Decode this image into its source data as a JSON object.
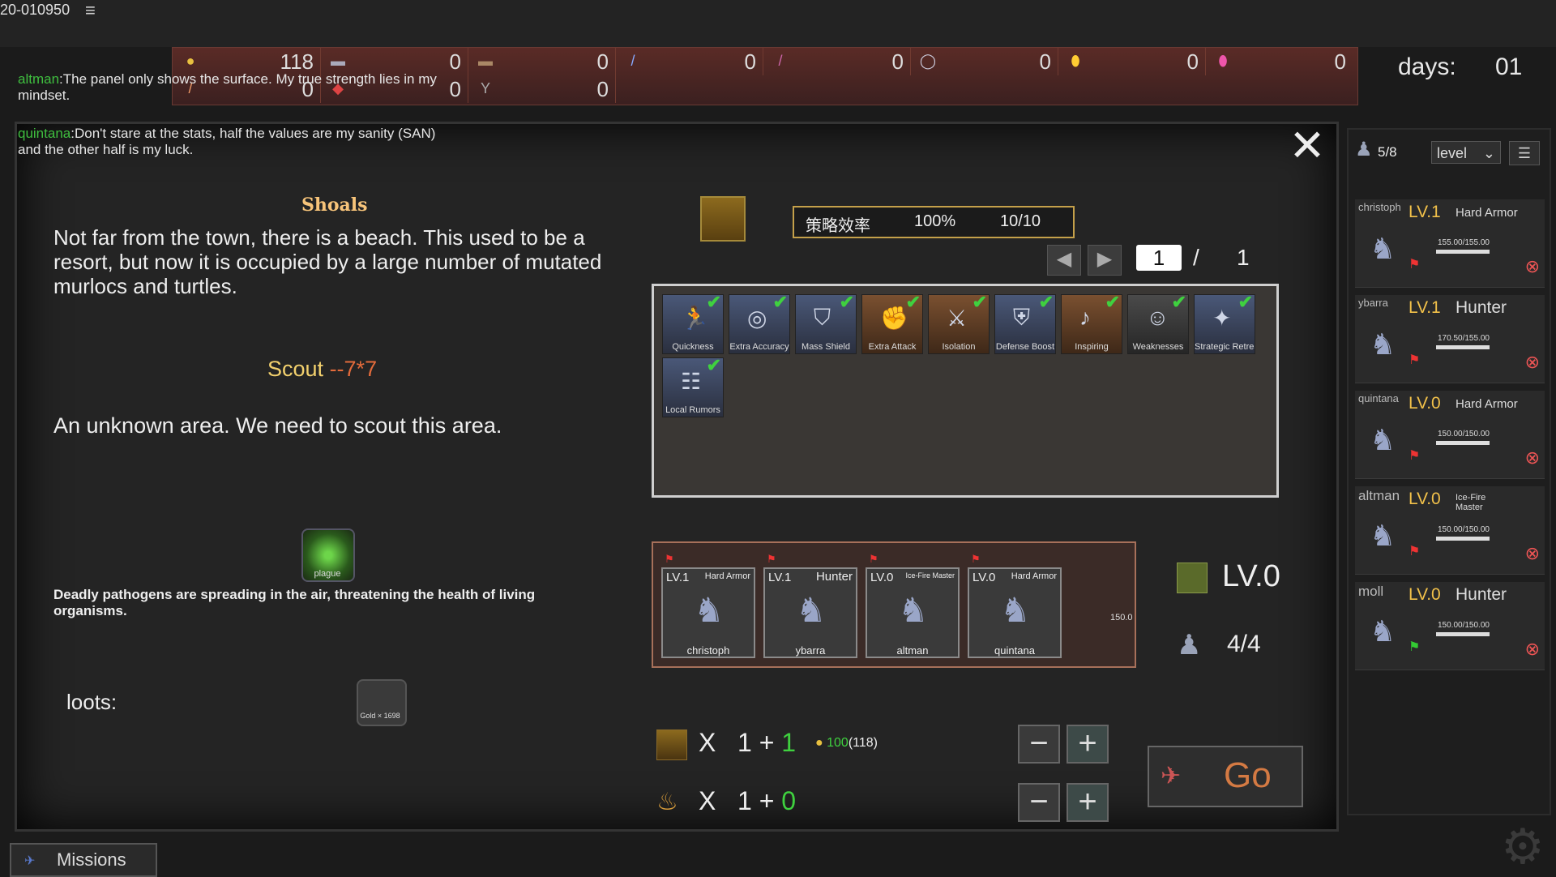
{
  "window": {
    "title": "20-010950",
    "menu_icon": "hamburger-icon"
  },
  "resources": [
    {
      "icon": "gold-icon",
      "value": "118"
    },
    {
      "icon": "wood-icon",
      "value": "0"
    },
    {
      "icon": "plank-icon",
      "value": "0"
    },
    {
      "icon": "feather-icon",
      "value": "0"
    },
    {
      "icon": "crystal-icon",
      "value": "0"
    },
    {
      "icon": "silver-ore-icon",
      "value": "0"
    },
    {
      "icon": "gold-ore-icon",
      "value": "0"
    },
    {
      "icon": "gem-icon",
      "value": "0"
    },
    {
      "icon": "torch-icon",
      "value": "0"
    },
    {
      "icon": "meat-icon",
      "value": "0"
    },
    {
      "icon": "herb-icon",
      "value": "0"
    }
  ],
  "days": {
    "label": "days:",
    "value": "01"
  },
  "chat": [
    {
      "name": "altman",
      "text": ":The panel only shows the surface. My true strength lies in my mindset."
    },
    {
      "name": "quintana",
      "text": ":Don't stare at the stats, half the values are my sanity (SAN) and the other half is my luck."
    }
  ],
  "mission": {
    "title": "Shoals",
    "description": "Not far from the town, there is a beach. This used to be a resort, but now it is occupied by a large number of mutated murlocs and turtles.",
    "scout_label": "Scout",
    "scout_value": "--7*7",
    "unknown_text": "An unknown area. We need to scout this area.",
    "plague_label": "plague",
    "plague_desc": "Deadly pathogens are spreading in the air, threatening the health of living organisms.",
    "loots_label": "loots:",
    "gold_loot_label": "Gold × 1698",
    "close_label": "✕"
  },
  "efficiency": {
    "label": "策略效率",
    "percent": "100%",
    "ratio": "10/10"
  },
  "pagination": {
    "current": "1",
    "separator": "/",
    "total": "1"
  },
  "skills": [
    {
      "label": "Quickness",
      "icon": "running-figure-icon"
    },
    {
      "label": "Extra Accuracy",
      "icon": "target-icon"
    },
    {
      "label": "Mass Shield",
      "icon": "shield-icon"
    },
    {
      "label": "Extra Attack",
      "icon": "fist-icon"
    },
    {
      "label": "Isolation",
      "icon": "isolation-icon"
    },
    {
      "label": "Defense Boost",
      "icon": "defense-icon"
    },
    {
      "label": "Inspiring",
      "icon": "horn-icon"
    },
    {
      "label": "Weaknesses",
      "icon": "weakness-icon"
    },
    {
      "label": "Strategic Retreat",
      "icon": "retreat-icon"
    },
    {
      "label": "Local Rumors",
      "icon": "rumors-icon"
    }
  ],
  "team": [
    {
      "level": "LV.1",
      "class": "Hard Armor",
      "name": "christoph"
    },
    {
      "level": "LV.1",
      "class": "Hunter",
      "name": "ybarra"
    },
    {
      "level": "LV.0",
      "class": "Ice-Fire Master",
      "name": "altman"
    },
    {
      "level": "LV.0",
      "class": "Hard Armor",
      "name": "quintana"
    }
  ],
  "team_hp": "150.0",
  "team_level": "LV.0",
  "team_count": "4/4",
  "supplies": [
    {
      "x": "X",
      "base": "1 +",
      "bonus": "1"
    },
    {
      "x": "X",
      "base": "1 +",
      "bonus": "0"
    }
  ],
  "gold_cost": {
    "used": "100",
    "total": "(118)"
  },
  "go_label": "Go",
  "sidebar": {
    "count": "5/8",
    "sort_value": "level",
    "characters": [
      {
        "name": "christoph",
        "level": "LV.1",
        "class": "Hard Armor",
        "hp": "155.00/155.00"
      },
      {
        "name": "ybarra",
        "level": "LV.1",
        "class": "Hunter",
        "hp": "170.50/155.00"
      },
      {
        "name": "quintana",
        "level": "LV.0",
        "class": "Hard Armor",
        "hp": "150.00/150.00"
      },
      {
        "name": "altman",
        "level": "LV.0",
        "class": "Ice-Fire Master",
        "hp": "150.00/150.00"
      },
      {
        "name": "moll",
        "level": "LV.0",
        "class": "Hunter",
        "hp": "150.00/150.00"
      }
    ]
  },
  "missions_tab": "Missions"
}
